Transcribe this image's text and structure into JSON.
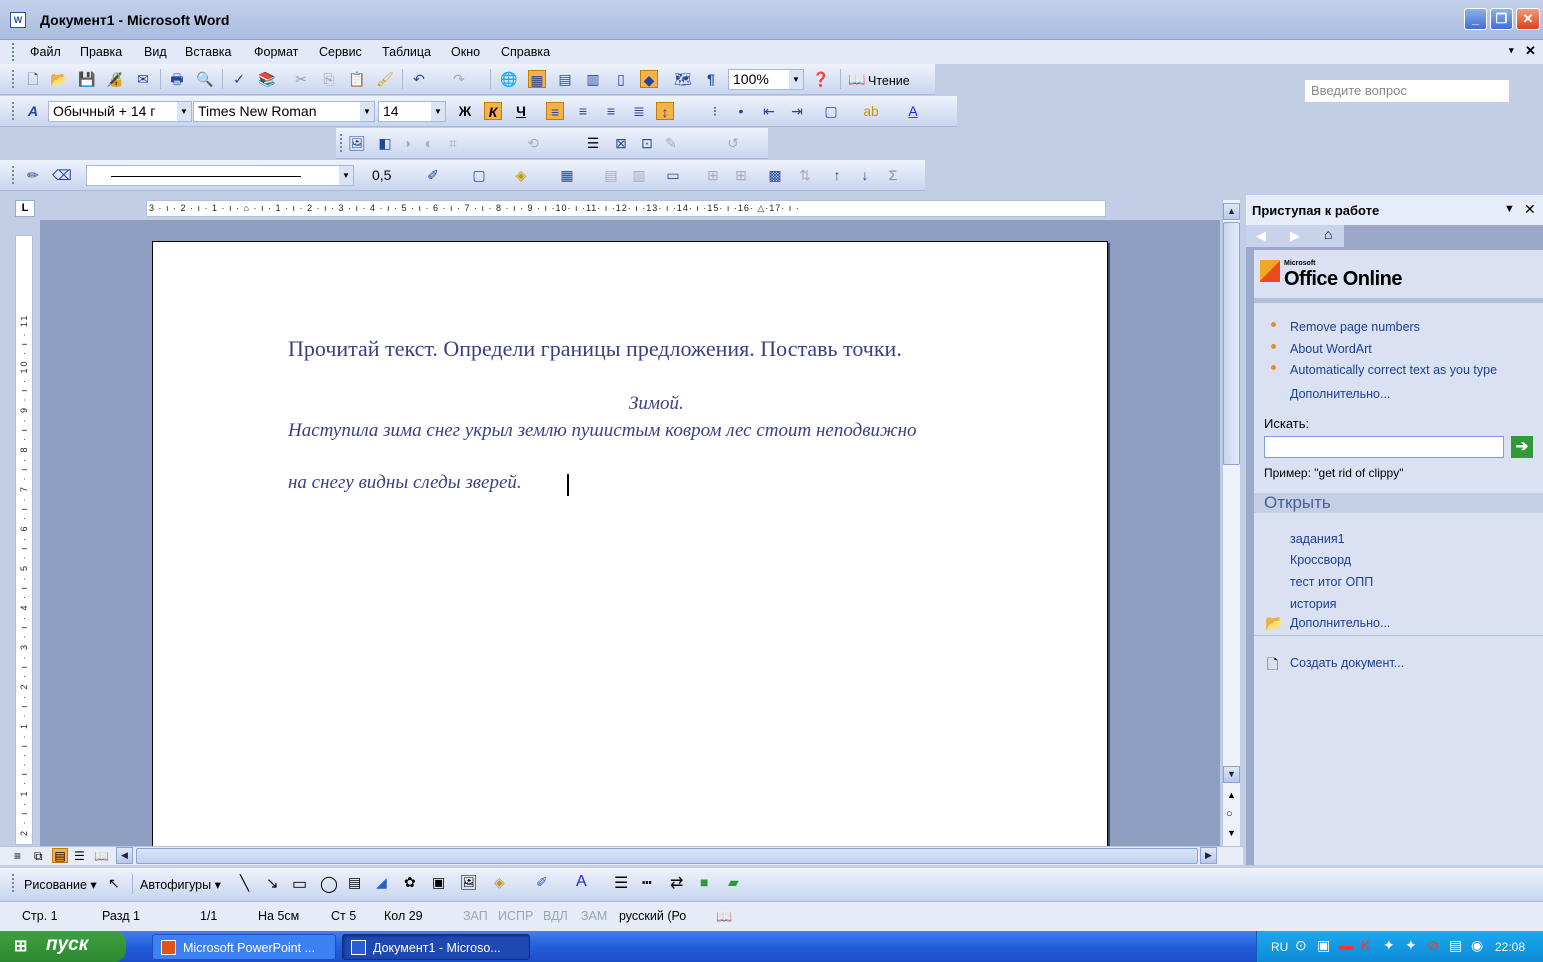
{
  "window": {
    "title": "Документ1 - Microsoft Word",
    "app_icon": "W"
  },
  "menu": {
    "items": [
      "Файл",
      "Правка",
      "Вид",
      "Вставка",
      "Формат",
      "Сервис",
      "Таблица",
      "Окно",
      "Справка"
    ],
    "ask_placeholder": "Введите вопрос"
  },
  "toolbar_standard": {
    "zoom": "100%",
    "reading_label": "Чтение"
  },
  "toolbar_formatting": {
    "style": "Обычный + 14 г",
    "font": "Times New Roman",
    "size": "14",
    "bold": "Ж",
    "italic": "К",
    "underline": "Ч"
  },
  "toolbar_tables": {
    "line_weight": "0,5"
  },
  "ruler": {
    "corner": "L",
    "h_ticks": "3 · ı · 2 · ı · 1 · ı · ⌂ · ı · 1 · ı · 2 · ı · 3 · ı · 4 · ı · 5 · ı · 6 · ı · 7 · ı · 8 · ı · 9 · ı ·10· ı ·11· ı ·12· ı ·13· ı ·14· ı ·15· ı ·16· △·17· ı ·",
    "v_ticks": "2 · ı · 1 · ı · · ı · 1 · ı · 2 · ı · 3 · ı · 4 · ı · 5 · ı · 6 · ı · 7 · ı · 8 · ı · 9 · ı · 10 · ı · 11"
  },
  "document": {
    "heading": "Прочитай текст. Определи границы предложения. Поставь точки.",
    "title": "Зимой.",
    "line1": "Наступила зима снег укрыл землю пушистым ковром лес стоит неподвижно",
    "line2": "на снегу видны следы зверей."
  },
  "taskpane": {
    "title": "Приступая к работе",
    "brand": "Office Online",
    "brand_small": "Microsoft",
    "links": [
      "Remove page numbers",
      "About WordArt",
      "Automatically correct text as you type"
    ],
    "more": "Дополнительно...",
    "search_label": "Искать:",
    "search_value": "",
    "example": "Пример: \"get rid of clippy\"",
    "open_title": "Открыть",
    "recent": [
      "задания1",
      "Кроссворд",
      "тест итог ОПП",
      "история"
    ],
    "open_more": "Дополнительно...",
    "create": "Создать документ..."
  },
  "drawing": {
    "draw_label": "Рисование ▾",
    "autoshapes_label": "Автофигуры ▾"
  },
  "status": {
    "page": "Стр. 1",
    "section": "Разд 1",
    "pages": "1/1",
    "at": "На 5см",
    "line": "Ст 5",
    "col": "Кол 29",
    "zap": "ЗАП",
    "ispr": "ИСПР",
    "vdl": "ВДЛ",
    "zam": "ЗАМ",
    "lang": "русский (Ро"
  },
  "taskbar": {
    "start": "пуск",
    "tasks": [
      "Microsoft PowerPoint ...",
      "Документ1 - Microso..."
    ],
    "lang": "RU",
    "clock": "22:08"
  },
  "colors": {
    "doc_text": "#3a3f86",
    "accent": "#f7b244",
    "taskbar": "#245ddb",
    "start": "#2b8a2f"
  }
}
